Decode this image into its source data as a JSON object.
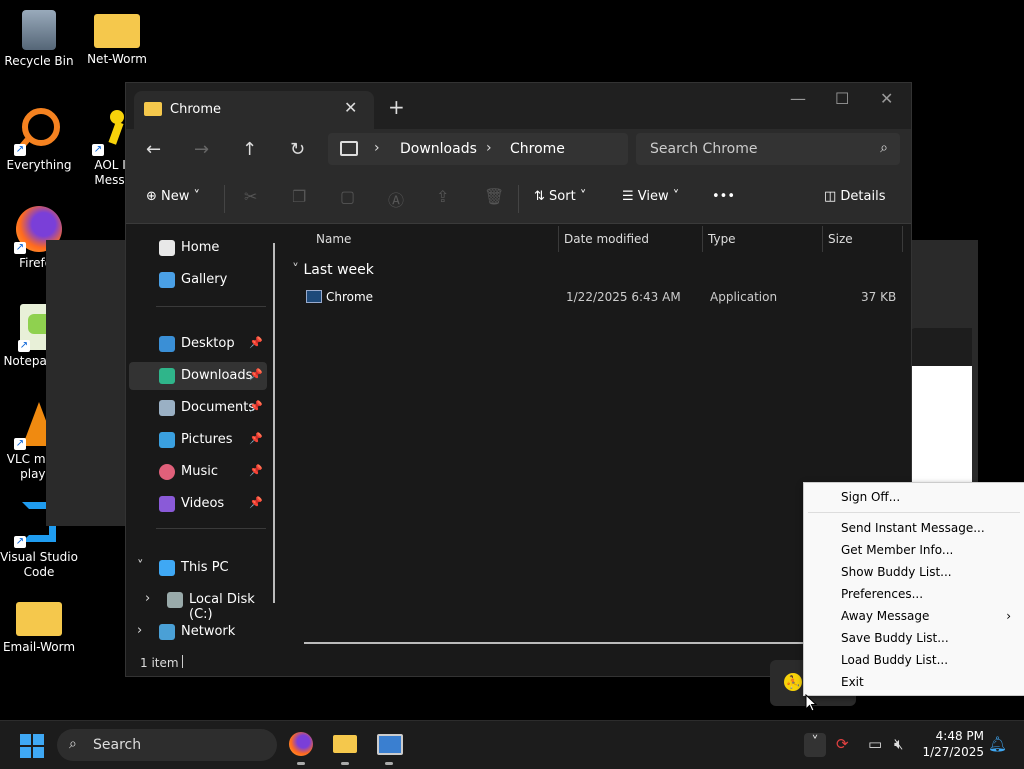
{
  "desktop": {
    "icons": [
      {
        "label": "Recycle Bin"
      },
      {
        "label": "Net-Worm"
      },
      {
        "label": "Everything"
      },
      {
        "label": "AOL Ins Messen"
      },
      {
        "label": "Firefox"
      },
      {
        "label": "Notepad++"
      },
      {
        "label": "VLC media player"
      },
      {
        "label": "Visual Studio Code"
      },
      {
        "label": "Email-Worm"
      }
    ]
  },
  "explorer": {
    "tab_title": "Chrome",
    "new_tab": "+",
    "breadcrumb": [
      "Downloads",
      "Chrome"
    ],
    "search_placeholder": "Search Chrome",
    "toolbar": {
      "new": "New",
      "sort": "Sort",
      "view": "View",
      "more": "•••",
      "details": "Details"
    },
    "sidebar": {
      "home": "Home",
      "gallery": "Gallery",
      "desktop": "Desktop",
      "downloads": "Downloads",
      "documents": "Documents",
      "pictures": "Pictures",
      "music": "Music",
      "videos": "Videos",
      "this_pc": "This PC",
      "local_disk": "Local Disk (C:)",
      "network": "Network"
    },
    "columns": [
      "Name",
      "Date modified",
      "Type",
      "Size"
    ],
    "group": "Last week",
    "files": [
      {
        "name": "Chrome",
        "date": "1/22/2025 6:43 AM",
        "type": "Application",
        "size": "37 KB"
      }
    ],
    "status": "1 item"
  },
  "context_menu": {
    "items": [
      "Sign Off...",
      "Send Instant Message...",
      "Get Member Info...",
      "Show Buddy List...",
      "Preferences...",
      "Away Message",
      "Save Buddy List...",
      "Load Buddy List...",
      "Exit"
    ]
  },
  "taskbar": {
    "search_placeholder": "Search",
    "time": "4:48 PM",
    "date": "1/27/2025"
  },
  "colors": {
    "accent": "#3fa8f4",
    "folder": "#f5c84c",
    "explorer_bg": "#191919"
  }
}
